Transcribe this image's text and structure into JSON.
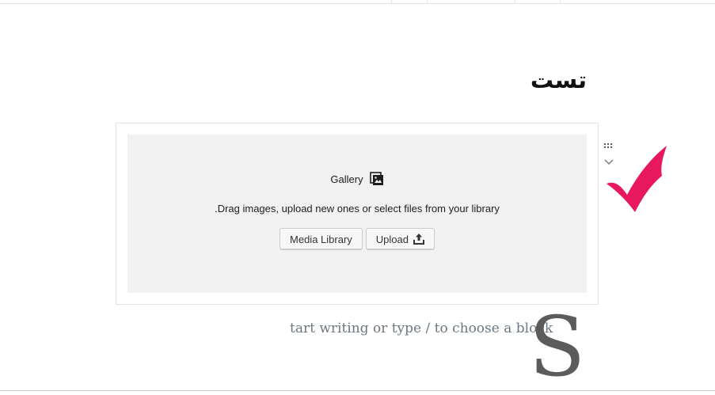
{
  "post": {
    "title": "تست"
  },
  "gallery_block": {
    "label": "Gallery",
    "icon": "gallery-icon",
    "instructions": ".Drag images, upload new ones or select files from your library",
    "buttons": {
      "media_library": "Media Library",
      "upload": "Upload"
    }
  },
  "block_mover": {
    "drag_icon": "drag-handle-icon",
    "down_icon": "chevron-down-icon"
  },
  "annotation": {
    "icon": "checkmark-icon",
    "color": "#e8185f"
  },
  "appender": {
    "placeholder": "tart writing or type / to choose a block",
    "drop_cap": "S"
  }
}
